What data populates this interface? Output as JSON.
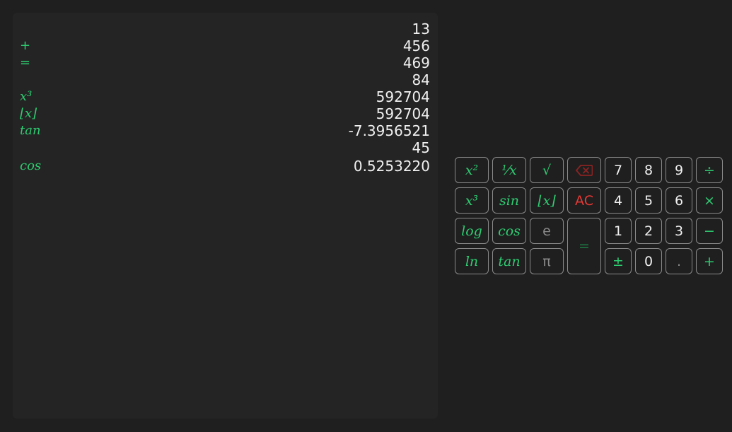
{
  "tape": [
    {
      "op": "",
      "value": "13",
      "fn": false
    },
    {
      "op": "+",
      "value": "456",
      "fn": false
    },
    {
      "op": "=",
      "value": "469",
      "fn": false
    },
    {
      "op": "",
      "value": "84",
      "fn": false
    },
    {
      "op": "x³",
      "value": "592704",
      "fn": true
    },
    {
      "op": "⌊x⌋",
      "value": "592704",
      "fn": true
    },
    {
      "op": "tan",
      "value": "-7.3956521",
      "fn": true
    },
    {
      "op": "",
      "value": "45",
      "fn": false
    },
    {
      "op": "cos",
      "value": "0.5253220",
      "fn": true
    }
  ],
  "keys": {
    "square": "x²",
    "reciprocal": "¹⁄x",
    "sqrt": "√",
    "backspace": "backspace-icon",
    "seven": "7",
    "eight": "8",
    "nine": "9",
    "divide": "÷",
    "cube": "x³",
    "sin": "sin",
    "floor": "⌊x⌋",
    "clear": "AC",
    "four": "4",
    "five": "5",
    "six": "6",
    "multiply": "×",
    "log": "log",
    "cos": "cos",
    "e": "e",
    "equals": "=",
    "one": "1",
    "two": "2",
    "three": "3",
    "minus": "−",
    "ln": "ln",
    "tan": "tan",
    "pi": "π",
    "plusminus": "±",
    "zero": "0",
    "decimal": ".",
    "plus": "+"
  },
  "colors": {
    "accent": "#2ecc71",
    "clear": "#e53935",
    "background": "#1f1f1f",
    "panel": "#242424"
  }
}
